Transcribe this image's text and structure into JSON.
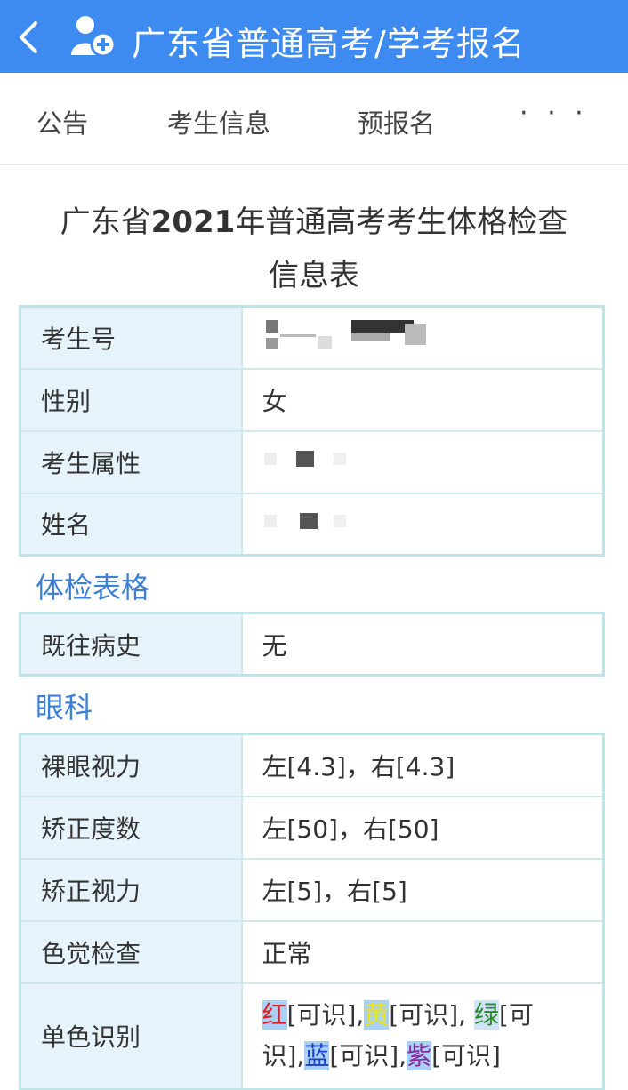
{
  "header": {
    "title": "广东省普通高考/学考报名",
    "back_icon": "chevron-left-icon",
    "logo_icon": "user-add-icon",
    "color": "#3d8af0"
  },
  "nav": {
    "items": [
      "公告",
      "考生信息",
      "预报名"
    ],
    "more": "· · ·"
  },
  "page_title": {
    "part1": "广东省",
    "year": "2021",
    "part2": "年普通高考考生体格检查",
    "line2": "信息表"
  },
  "basic_info": {
    "rows": [
      {
        "label": "考生号",
        "value": ""
      },
      {
        "label": "性别",
        "value": "女"
      },
      {
        "label": "考生属性",
        "value": ""
      },
      {
        "label": "姓名",
        "value": ""
      }
    ]
  },
  "section_physical": {
    "title": "体检表格",
    "rows": [
      {
        "label": "既往病史",
        "value": "无"
      }
    ]
  },
  "section_eye": {
    "title": "眼科",
    "rows": [
      {
        "label": "裸眼视力",
        "value": "左[4.3]，右[4.3]"
      },
      {
        "label": "矫正度数",
        "value": "左[50]，右[50]"
      },
      {
        "label": "矫正视力",
        "value": "左[5]，右[5]"
      },
      {
        "label": "色觉检查",
        "value": "正常"
      }
    ],
    "color_recognition": {
      "label": "单色识别",
      "red": "红",
      "red_result": "[可识],",
      "yellow": "黄",
      "yellow_result": "[可识], ",
      "green": "绿",
      "green_result": "[可识],",
      "blue": "蓝",
      "blue_result": "[可识],",
      "purple": "紫",
      "purple_result": "[可识]"
    }
  }
}
